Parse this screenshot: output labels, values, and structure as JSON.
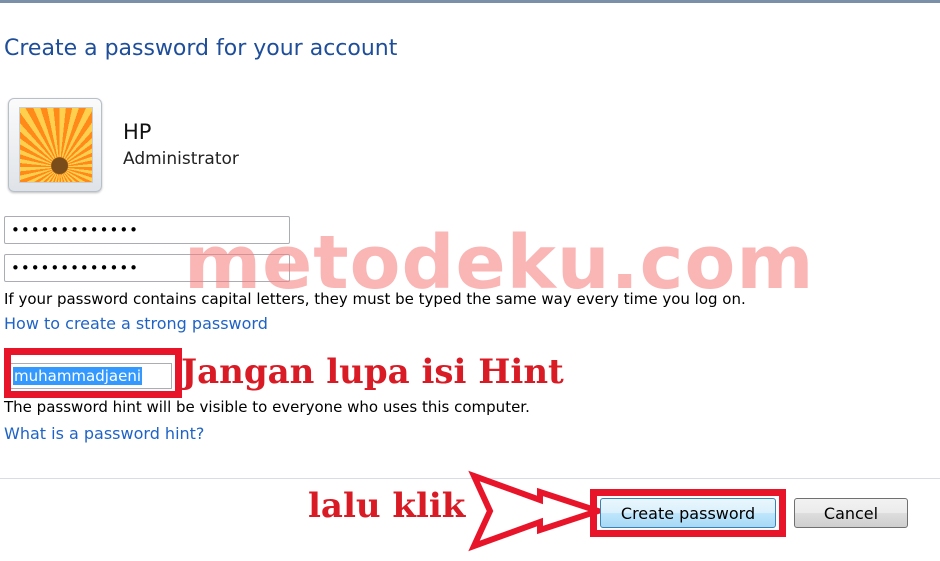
{
  "header": {
    "title": "Create a password for your account"
  },
  "account": {
    "name": "HP",
    "role": "Administrator",
    "avatar": "flower-picture"
  },
  "password": {
    "new_value": "•••••••••••••",
    "confirm_value": "•••••••••••••"
  },
  "notes": {
    "capital_letters": "If your password contains capital letters, they must be typed the same way every time you log on.",
    "hint_visibility": "The password hint will be visible to everyone who uses this computer."
  },
  "links": {
    "strong_password": "How to create a strong password",
    "password_hint": "What is a password hint?"
  },
  "hint": {
    "value": "muhammadjaeni"
  },
  "annotations": {
    "watermark": "metodeku.com",
    "hint_reminder": "Jangan lupa isi Hint",
    "click_instruction": "lalu klik",
    "highlight_color": "#e8152a"
  },
  "buttons": {
    "create": "Create password",
    "cancel": "Cancel"
  }
}
